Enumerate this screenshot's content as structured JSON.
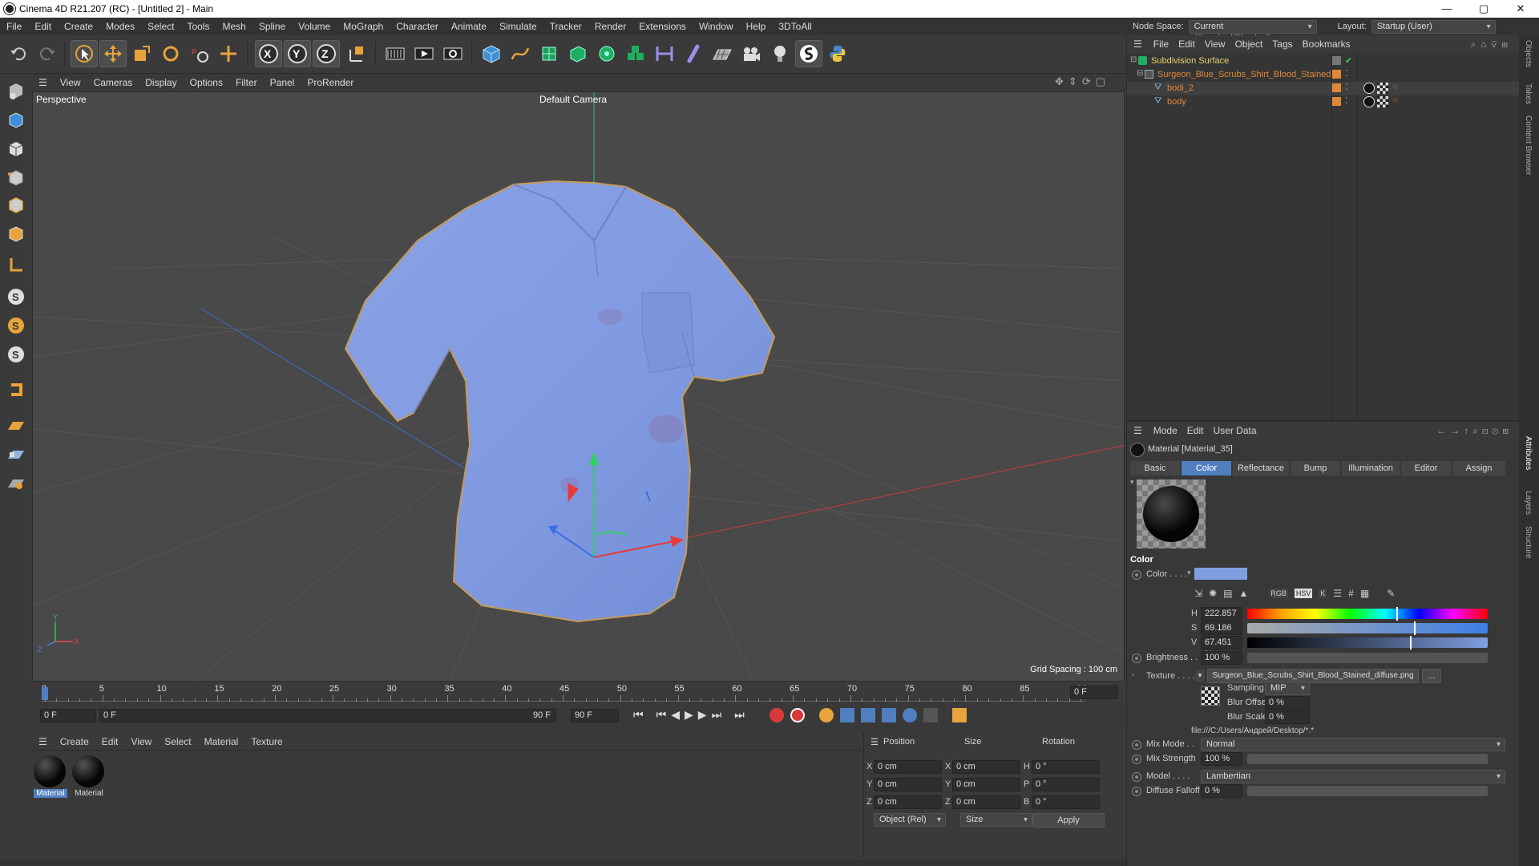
{
  "window": {
    "title": "Cinema 4D R21.207 (RC) - [Untitled 2] - Main",
    "controls": [
      "—",
      "▢",
      "✕"
    ]
  },
  "menubar": [
    "File",
    "Edit",
    "Create",
    "Modes",
    "Select",
    "Tools",
    "Mesh",
    "Spline",
    "Volume",
    "MoGraph",
    "Character",
    "Animate",
    "Simulate",
    "Tracker",
    "Render",
    "Extensions",
    "Window",
    "Help",
    "3DToAll"
  ],
  "nodespace": {
    "label": "Node Space:",
    "value": "Current (Standard/Physical)",
    "layout_label": "Layout:",
    "layout_value": "Startup (User)"
  },
  "viewport": {
    "menu": [
      "View",
      "Cameras",
      "Display",
      "Options",
      "Filter",
      "Panel",
      "ProRender"
    ],
    "projection": "Perspective",
    "camera": "Default Camera",
    "grid_spacing": "Grid Spacing : 100 cm",
    "axis_labels": {
      "x": "X",
      "y": "Y",
      "z": "Z"
    }
  },
  "timeline": {
    "ticks": [
      "0",
      "5",
      "10",
      "15",
      "20",
      "25",
      "30",
      "35",
      "40",
      "45",
      "50",
      "55",
      "60",
      "65",
      "70",
      "75",
      "80",
      "85",
      "90"
    ],
    "current_frame": "0 F",
    "start": "0 F",
    "range_start": "0 F",
    "range_end": "90 F",
    "end": "90 F"
  },
  "material_manager": {
    "menu": [
      "Create",
      "Edit",
      "View",
      "Select",
      "Material",
      "Texture"
    ],
    "materials": [
      {
        "name": "Material",
        "selected": true
      },
      {
        "name": "Material",
        "selected": false
      }
    ]
  },
  "coordinates": {
    "headers": [
      "Position",
      "Size",
      "Rotation"
    ],
    "rows": [
      {
        "axis": "X",
        "pos": "0 cm",
        "size_axis": "X",
        "size": "0 cm",
        "rot_axis": "H",
        "rot": "0 °"
      },
      {
        "axis": "Y",
        "pos": "0 cm",
        "size_axis": "Y",
        "size": "0 cm",
        "rot_axis": "P",
        "rot": "0 °"
      },
      {
        "axis": "Z",
        "pos": "0 cm",
        "size_axis": "Z",
        "size": "0 cm",
        "rot_axis": "B",
        "rot": "0 °"
      }
    ],
    "mode": "Object (Rel)",
    "size_mode": "Size",
    "apply": "Apply"
  },
  "object_manager": {
    "menu": [
      "File",
      "Edit",
      "View",
      "Object",
      "Tags",
      "Bookmarks"
    ],
    "objects": [
      {
        "name": "Subdivision Surface",
        "level": 0,
        "color": "#e8d36a"
      },
      {
        "name": "Surgeon_Blue_Scrubs_Shirt_Blood_Stained",
        "level": 1,
        "color": "#e0883a"
      },
      {
        "name": "bodi_2",
        "level": 2,
        "color": "#e0883a"
      },
      {
        "name": "body",
        "level": 2,
        "color": "#e0883a"
      }
    ]
  },
  "attributes": {
    "menu": [
      "Mode",
      "Edit",
      "User Data"
    ],
    "material_name": "Material [Material_35]",
    "tabs": [
      "Basic",
      "Color",
      "Reflectance",
      "Bump",
      "Illumination",
      "Editor",
      "Assign"
    ],
    "active_tab": "Color",
    "section": "Color",
    "color_label": "Color . . . .",
    "color_value": "#7f9ee0",
    "h": {
      "label": "H",
      "value": "222.857 °",
      "fraction": 0.619
    },
    "s": {
      "label": "S",
      "value": "69.186 %",
      "fraction": 0.692
    },
    "v": {
      "label": "V",
      "value": "67.451 %",
      "fraction": 0.675
    },
    "picker_modes": [
      "RGB",
      "HSV",
      "K"
    ],
    "brightness": {
      "label": "Brightness . .",
      "value": "100 %"
    },
    "texture": {
      "label": "Texture . . . .",
      "file": "Surgeon_Blue_Scrubs_Shirt_Blood_Stained_diffuse.png",
      "more": "..."
    },
    "sampling": {
      "label": "Sampling",
      "value": "MIP"
    },
    "blur_offset": {
      "label": "Blur Offset",
      "value": "0 %"
    },
    "blur_scale": {
      "label": "Blur Scale",
      "value": "0 %"
    },
    "path": "file:///C:/Users/Андрей/Desktop/*.*",
    "mix_mode": {
      "label": "Mix Mode . .",
      "value": "Normal"
    },
    "mix_strength": {
      "label": "Mix Strength",
      "value": "100 %"
    },
    "model": {
      "label": "Model . . . .",
      "value": "Lambertian"
    },
    "diffuse_falloff": {
      "label": "Diffuse Falloff",
      "value": "0 %"
    }
  },
  "side_tabs": [
    "Objects",
    "Takes",
    "Content Browser",
    "Attributes",
    "Layers",
    "Structure"
  ]
}
